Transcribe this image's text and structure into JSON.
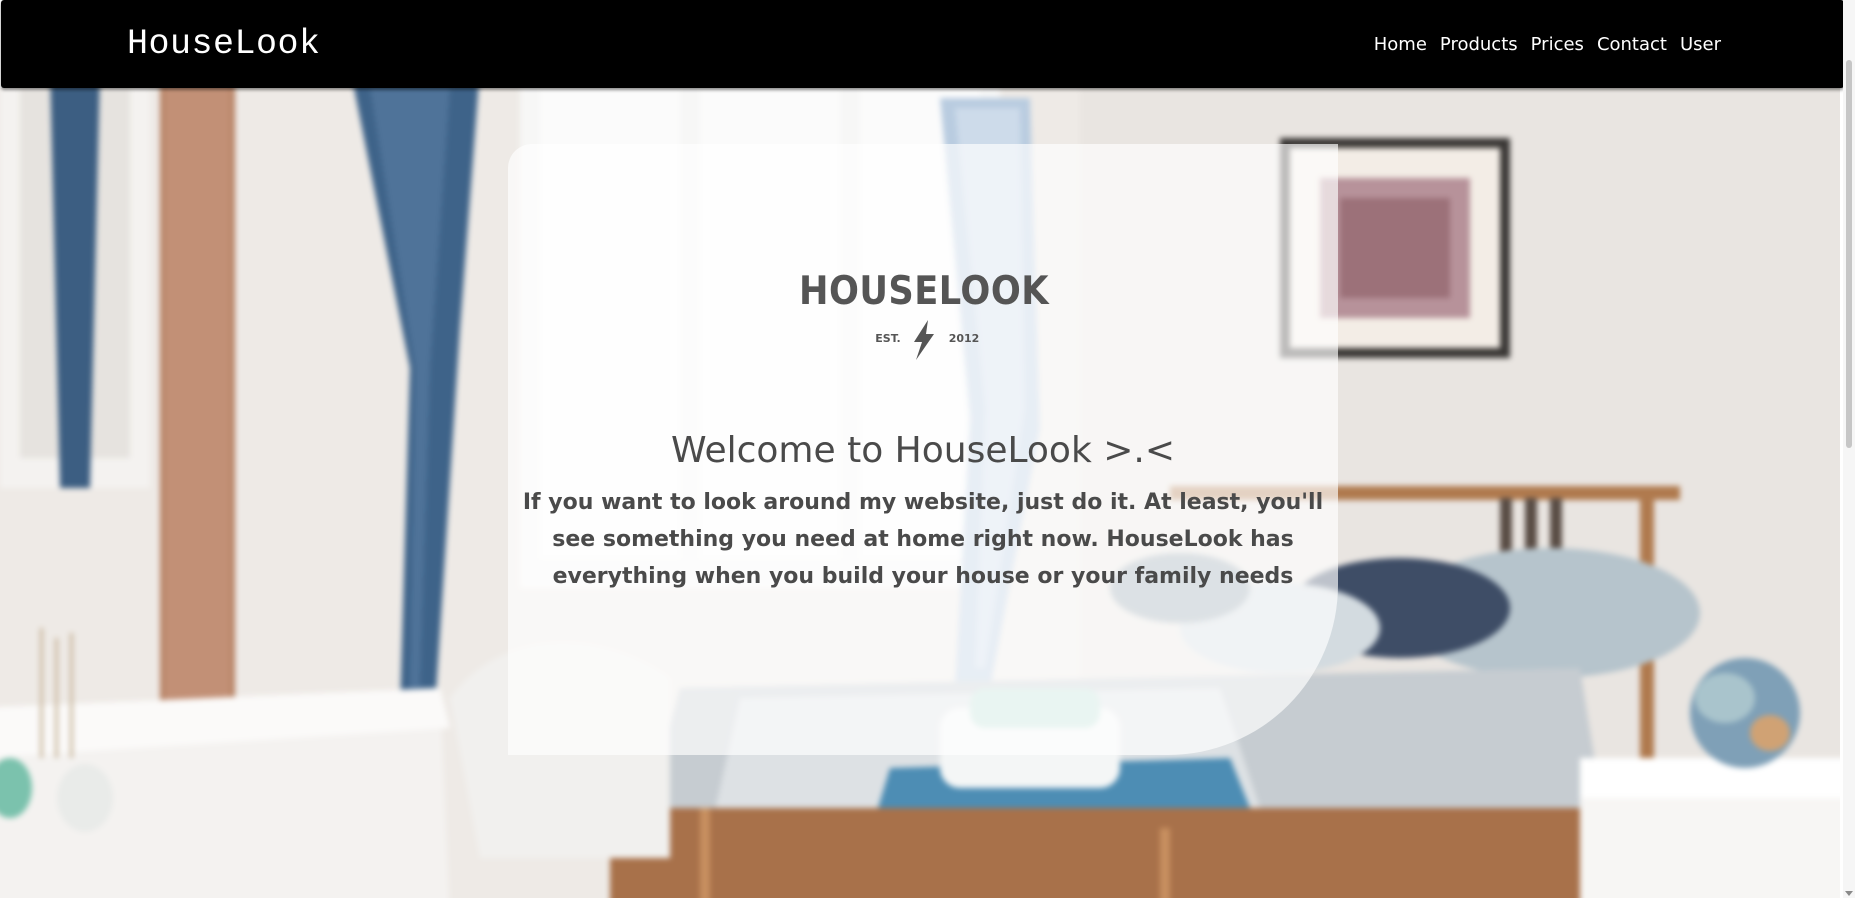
{
  "navbar": {
    "brand": "HouseLook",
    "links": [
      "Home",
      "Products",
      "Prices",
      "Contact",
      "User"
    ]
  },
  "hero": {
    "logo": {
      "wordmark": "HOUSELOOK",
      "est_left": "EST.",
      "est_right": "2012",
      "icon": "lightning-bolt-icon"
    },
    "title": "Welcome to HouseLook >.<",
    "text": "If you want to look around my website, just do it. At least, you'll see something you need at home right now. HouseLook has everything when you build your house or your family needs"
  },
  "colors": {
    "navbar_bg": "#000000",
    "nav_text": "#ffffff",
    "card_bg": "rgba(255,255,255,0.66)",
    "heading_text": "#4a4a4a",
    "logo_color": "#555555"
  }
}
